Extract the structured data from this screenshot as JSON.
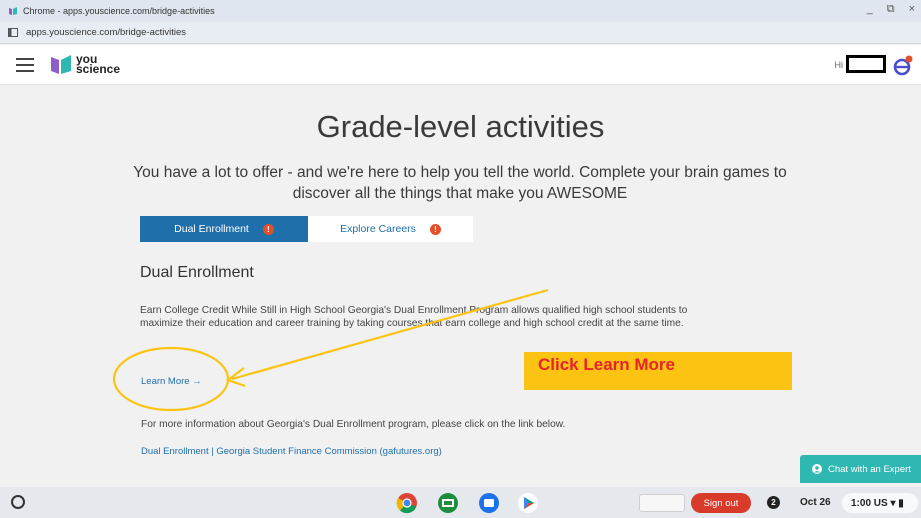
{
  "window": {
    "title": "Chrome - apps.youscience.com/bridge-activities",
    "minimize": "_",
    "restore": "⧉",
    "close": "×"
  },
  "address_bar": {
    "url": "apps.youscience.com/bridge-activities"
  },
  "header": {
    "logo_line1": "you",
    "logo_line2": "science",
    "greeting": "Hi"
  },
  "main": {
    "title": "Grade-level activities",
    "subtitle": "You have a lot to offer - and we're here to help you tell the world. Complete your brain games to discover all the things that make you AWESOME",
    "tabs": [
      {
        "label": "Dual Enrollment",
        "badge": "!"
      },
      {
        "label": "Explore Careers",
        "badge": "!"
      }
    ],
    "section_title": "Dual Enrollment",
    "body": "Earn College Credit While Still in High School Georgia's Dual Enrollment Program allows qualified high school students to maximize their education and career training by taking courses that earn college and high school credit at the same time.",
    "learn_more": "Learn More →",
    "more_info": "For more information about Georgia's Dual Enrollment program, please click on the link below.",
    "link": "Dual Enrollment | Georgia Student Finance Commission (gafutures.org)"
  },
  "annotation": {
    "callout": "Click Learn More"
  },
  "chat": {
    "label": "Chat with an Expert"
  },
  "taskbar": {
    "sign_out": "Sign out",
    "notifications": "2",
    "date": "Oct 26",
    "status": "1:00 US ▾ ▮"
  },
  "colors": {
    "primary": "#1f6fab",
    "badge": "#e5502a",
    "callout_bg": "#fcc313",
    "callout_text": "#e5242b",
    "chat": "#2fb7b2",
    "sign_out": "#d93b2b"
  }
}
